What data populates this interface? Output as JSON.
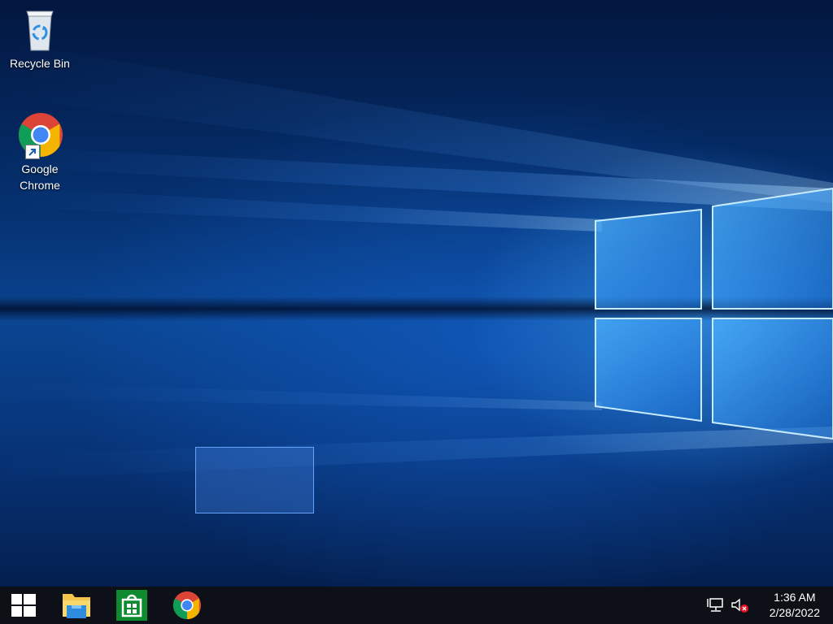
{
  "desktop": {
    "icons": [
      {
        "label": "Recycle Bin",
        "icon": "recycle-bin-icon"
      },
      {
        "label_line1": "Google",
        "label_line2": "Chrome",
        "icon": "chrome-icon",
        "shortcut": true
      }
    ]
  },
  "taskbar": {
    "start_icon": "windows-logo-icon",
    "pinned": [
      {
        "name": "File Explorer",
        "icon": "file-explorer-icon"
      },
      {
        "name": "Microsoft Store",
        "icon": "store-icon"
      },
      {
        "name": "Google Chrome",
        "icon": "chrome-icon"
      }
    ],
    "tray": {
      "network_icon": "network-icon",
      "volume_icon": "volume-muted-icon"
    },
    "clock": {
      "time": "1:36 AM",
      "date": "2/28/2022"
    }
  },
  "colors": {
    "taskbar": "#0d1117",
    "wallpaper_deep": "#02173f",
    "wallpaper_glow": "#46aaff",
    "store_green": "#0f8a2f"
  }
}
